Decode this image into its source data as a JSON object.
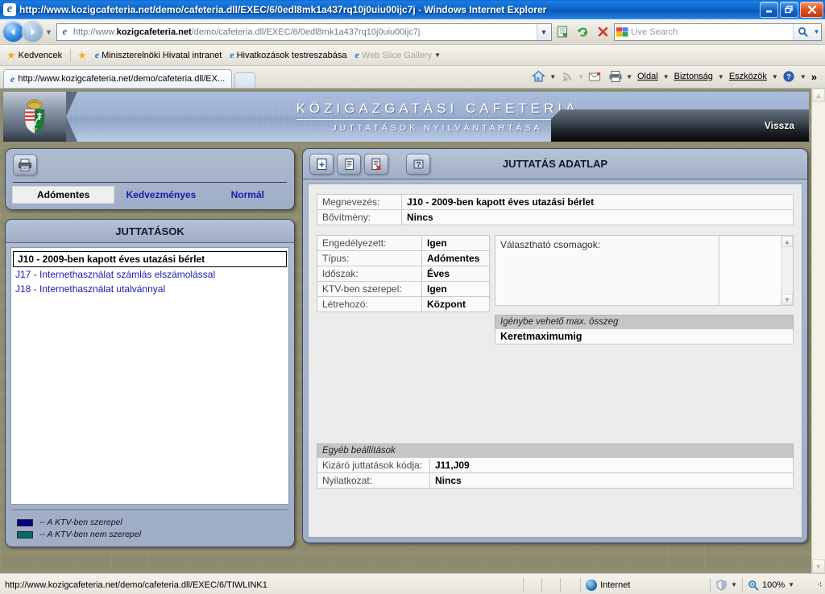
{
  "browser": {
    "window_title": "http://www.kozigcafeteria.net/demo/cafeteria.dll/EXEC/6/0edl8mk1a437rq10j0uiu00ijc7j - Windows Internet Explorer",
    "minimize_label": "–",
    "restore_label": "❐",
    "close_label": "✕",
    "address": {
      "protocol_prefix": "http://www.",
      "domain": "kozigcafeteria.net",
      "path": "/demo/cafeteria.dll/EXEC/6/0edl8mk1a437rq10j0uiu00ijc7j",
      "full": "http://www.kozigcafeteria.net/demo/cafeteria.dll/EXEC/6/0edl8mk1a437rq10j0uiu00ijc7j"
    },
    "search": {
      "placeholder": "Live Search"
    },
    "favorites_bar": {
      "favorites_label": "Kedvencek",
      "items": [
        {
          "label": "Miniszterelnöki Hivatal intranet",
          "dimmed": false
        },
        {
          "label": "Hivatkozások testreszabása",
          "dimmed": false
        },
        {
          "label": "Web Slice Gallery",
          "dimmed": true
        }
      ]
    },
    "tab": {
      "label": "http://www.kozigcafeteria.net/demo/cafeteria.dll/EX..."
    },
    "command_bar": {
      "page_label": "Oldal",
      "security_label": "Biztonság",
      "tools_label": "Eszközök",
      "overflow_label": "»"
    },
    "status": {
      "link_url": "http://www.kozigcafeteria.net/demo/cafeteria.dll/EXEC/6/TIWLINK1",
      "zone": "Internet",
      "zoom": "100%"
    }
  },
  "app": {
    "banner": {
      "title": "KÖZIGAZGATÁSI CAFETERIA",
      "subtitle": "JUTTATÁSOK NYILVÁNTARTÁSA",
      "back_label": "Vissza"
    },
    "type_tabs": {
      "print_icon": "printer-icon",
      "items": [
        {
          "label": "Adómentes",
          "active": true
        },
        {
          "label": "Kedvezményes",
          "active": false
        },
        {
          "label": "Normál",
          "active": false
        }
      ]
    },
    "benefits_panel": {
      "header": "JUTTATÁSOK",
      "items": [
        {
          "label": "J10 - 2009-ben kapott éves utazási bérlet",
          "selected": true
        },
        {
          "label": "J17 - Internethasználat számlás elszámolással",
          "selected": false
        },
        {
          "label": "J18 - Internethasználat utalvánnyal",
          "selected": false
        }
      ],
      "legend": [
        {
          "color": "#00008b",
          "text": "-- A KTV-ben szerepel"
        },
        {
          "color": "#0a6b6b",
          "text": "-- A KTV-ben nem szerepel"
        }
      ]
    },
    "detail_panel": {
      "title": "JUTTATÁS ADATLAP",
      "toolbar": [
        {
          "name": "new-record-icon",
          "title": "Új"
        },
        {
          "name": "edit-record-icon",
          "title": "Módosítás"
        },
        {
          "name": "delete-record-icon",
          "title": "Törlés"
        },
        {
          "name": "help-icon",
          "title": "Súgó"
        }
      ],
      "top_fields": [
        {
          "label": "Megnevezés:",
          "value": "J10 - 2009-ben kapott éves utazási bérlet"
        },
        {
          "label": "Bővítmény:",
          "value": "Nincs"
        }
      ],
      "main_fields": [
        {
          "label": "Engedélyezett:",
          "value": "Igen"
        },
        {
          "label": "Típus:",
          "value": "Adómentes"
        },
        {
          "label": "Időszak:",
          "value": "Éves"
        },
        {
          "label": "KTV-ben szerepel:",
          "value": "Igen"
        },
        {
          "label": "Létrehozó:",
          "value": "Központ"
        }
      ],
      "packages": {
        "label": "Választható csomagok:",
        "items": []
      },
      "max_amount": {
        "header": "Igénybe vehető max. összeg",
        "value": "Keretmaximumig"
      },
      "other_settings": {
        "header": "Egyéb beállítások",
        "fields": [
          {
            "label": "Kizáró juttatások kódja:",
            "value": "J11,J09"
          },
          {
            "label": "Nyilatkozat:",
            "value": "Nincs"
          }
        ]
      }
    }
  }
}
